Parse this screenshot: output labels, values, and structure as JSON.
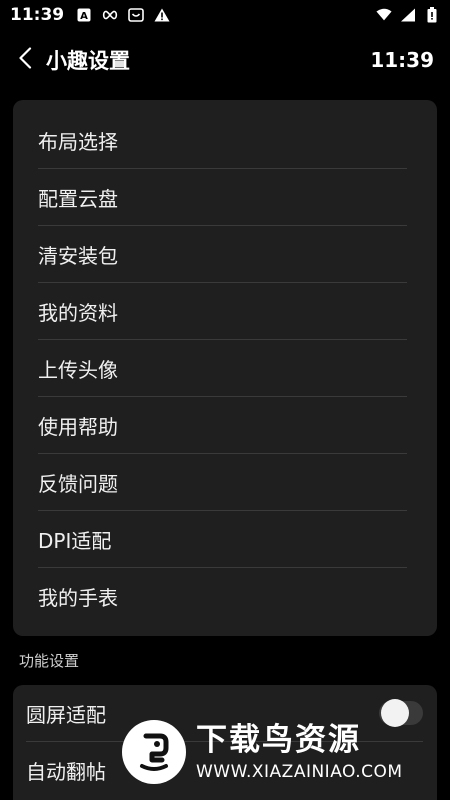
{
  "status_bar": {
    "time": "11:39",
    "left_icons": [
      "a-notification-icon",
      "infinity-icon",
      "face-box-icon",
      "warning-icon"
    ],
    "right_icons": [
      "wifi-icon",
      "cellular-signal-icon",
      "battery-icon"
    ]
  },
  "header": {
    "back_icon": "chevron-left-icon",
    "title": "小趣设置",
    "time": "11:39"
  },
  "menu": {
    "items": [
      {
        "label": "布局选择"
      },
      {
        "label": "配置云盘"
      },
      {
        "label": "清安装包"
      },
      {
        "label": "我的资料"
      },
      {
        "label": "上传头像"
      },
      {
        "label": "使用帮助"
      },
      {
        "label": "反馈问题"
      },
      {
        "label": "DPI适配"
      },
      {
        "label": "我的手表"
      }
    ]
  },
  "function_settings": {
    "section_label": "功能设置",
    "rows": [
      {
        "label": "圆屏适配",
        "toggle_on": false
      },
      {
        "label": "自动翻帖"
      }
    ]
  },
  "watermark": {
    "title": "下载鸟资源",
    "url": "WWW.XIAZAINIAO.COM"
  }
}
